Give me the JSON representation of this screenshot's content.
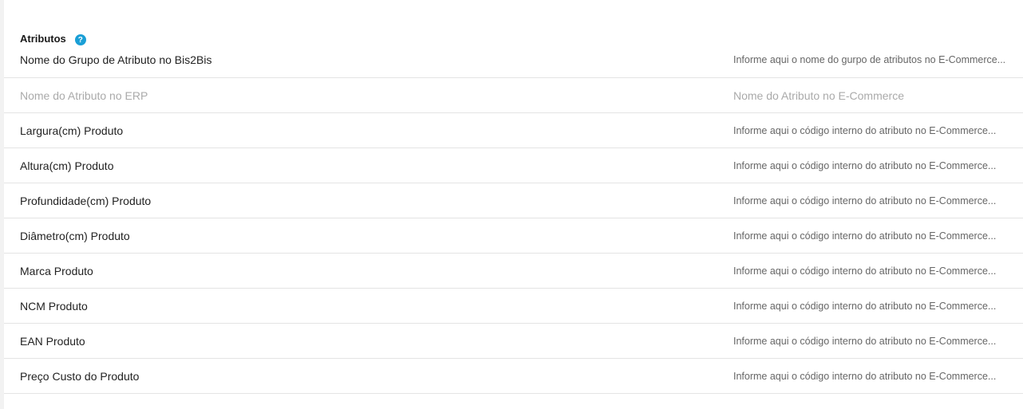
{
  "section": {
    "title": "Atributos",
    "help_icon": "?"
  },
  "group_row": {
    "label": "Nome do Grupo de Atributo no Bis2Bis",
    "placeholder": "Informe aqui o nome do gurpo de atributos no E-Commerce..."
  },
  "columns": {
    "left": "Nome do Atributo no ERP",
    "right": "Nome do Atributo no E-Commerce"
  },
  "attributes": [
    {
      "label": "Largura(cm) Produto",
      "placeholder": "Informe aqui o código interno do atributo no E-Commerce..."
    },
    {
      "label": "Altura(cm) Produto",
      "placeholder": "Informe aqui o código interno do atributo no E-Commerce..."
    },
    {
      "label": "Profundidade(cm) Produto",
      "placeholder": "Informe aqui o código interno do atributo no E-Commerce..."
    },
    {
      "label": "Diâmetro(cm) Produto",
      "placeholder": "Informe aqui o código interno do atributo no E-Commerce..."
    },
    {
      "label": "Marca Produto",
      "placeholder": "Informe aqui o código interno do atributo no E-Commerce..."
    },
    {
      "label": "NCM Produto",
      "placeholder": "Informe aqui o código interno do atributo no E-Commerce..."
    },
    {
      "label": "EAN Produto",
      "placeholder": "Informe aqui o código interno do atributo no E-Commerce..."
    },
    {
      "label": "Preço Custo do Produto",
      "placeholder": "Informe aqui o código interno do atributo no E-Commerce..."
    }
  ],
  "colors": {
    "accent": "#1a9fd6",
    "divider": "#e4e4e4",
    "muted_text": "#aaaaaa"
  }
}
